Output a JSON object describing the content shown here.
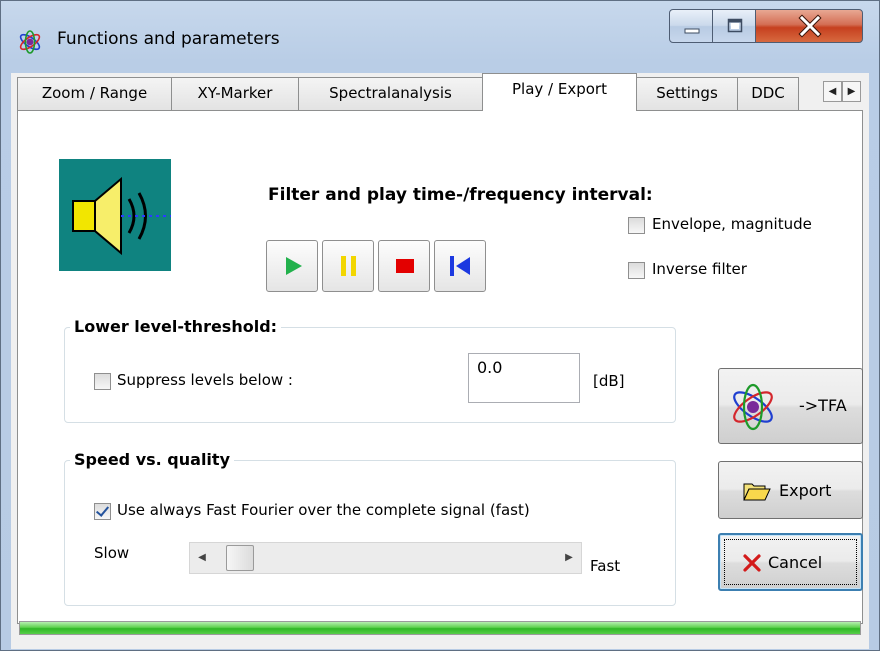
{
  "window": {
    "title": "Functions and parameters",
    "icons": {
      "app": "atom-icon",
      "minimize": "minimize-icon",
      "maximize": "maximize-icon",
      "close": "close-icon"
    }
  },
  "tabs": [
    {
      "label": "Zoom / Range",
      "active": false
    },
    {
      "label": "XY-Marker",
      "active": false
    },
    {
      "label": "Spectralanalysis",
      "active": false
    },
    {
      "label": "Play / Export",
      "active": true
    },
    {
      "label": "Settings",
      "active": false
    },
    {
      "label": "DDC",
      "active": false
    }
  ],
  "tab_scroll": {
    "left_icon": "triangle-left-icon",
    "right_icon": "triangle-right-icon"
  },
  "play": {
    "heading": "Filter and play time-/frequency interval:",
    "speaker_icon": "speaker-icon",
    "buttons": [
      {
        "icon": "play-icon",
        "color": "#22b14c"
      },
      {
        "icon": "pause-icon",
        "color": "#f2d600"
      },
      {
        "icon": "stop-icon",
        "color": "#e30000"
      },
      {
        "icon": "rewind-to-start-icon",
        "color": "#1c39e0"
      }
    ],
    "envelope": {
      "label": "Envelope, magnitude",
      "checked": false
    },
    "inverse": {
      "label": "Inverse filter",
      "checked": false
    }
  },
  "threshold": {
    "title": "Lower level-threshold:",
    "suppress": {
      "label": "Suppress levels below :",
      "checked": false
    },
    "value": "0.0",
    "unit": "[dB]"
  },
  "speed": {
    "title": "Speed vs. quality",
    "fft": {
      "label": "Use always Fast Fourier over the complete signal (fast)",
      "checked": true
    },
    "slow_label": "Slow",
    "fast_label": "Fast",
    "slider_level": 0.0
  },
  "actions": {
    "tfa": {
      "label": "->TFA",
      "icon": "atom-icon"
    },
    "export": {
      "label": "Export",
      "icon": "folder-open-icon"
    },
    "cancel": {
      "label": "Cancel",
      "icon": "cross-icon",
      "icon_color": "#d31a1a"
    }
  },
  "status_bar": {
    "fill": 1.0,
    "color": "#2fb725"
  }
}
